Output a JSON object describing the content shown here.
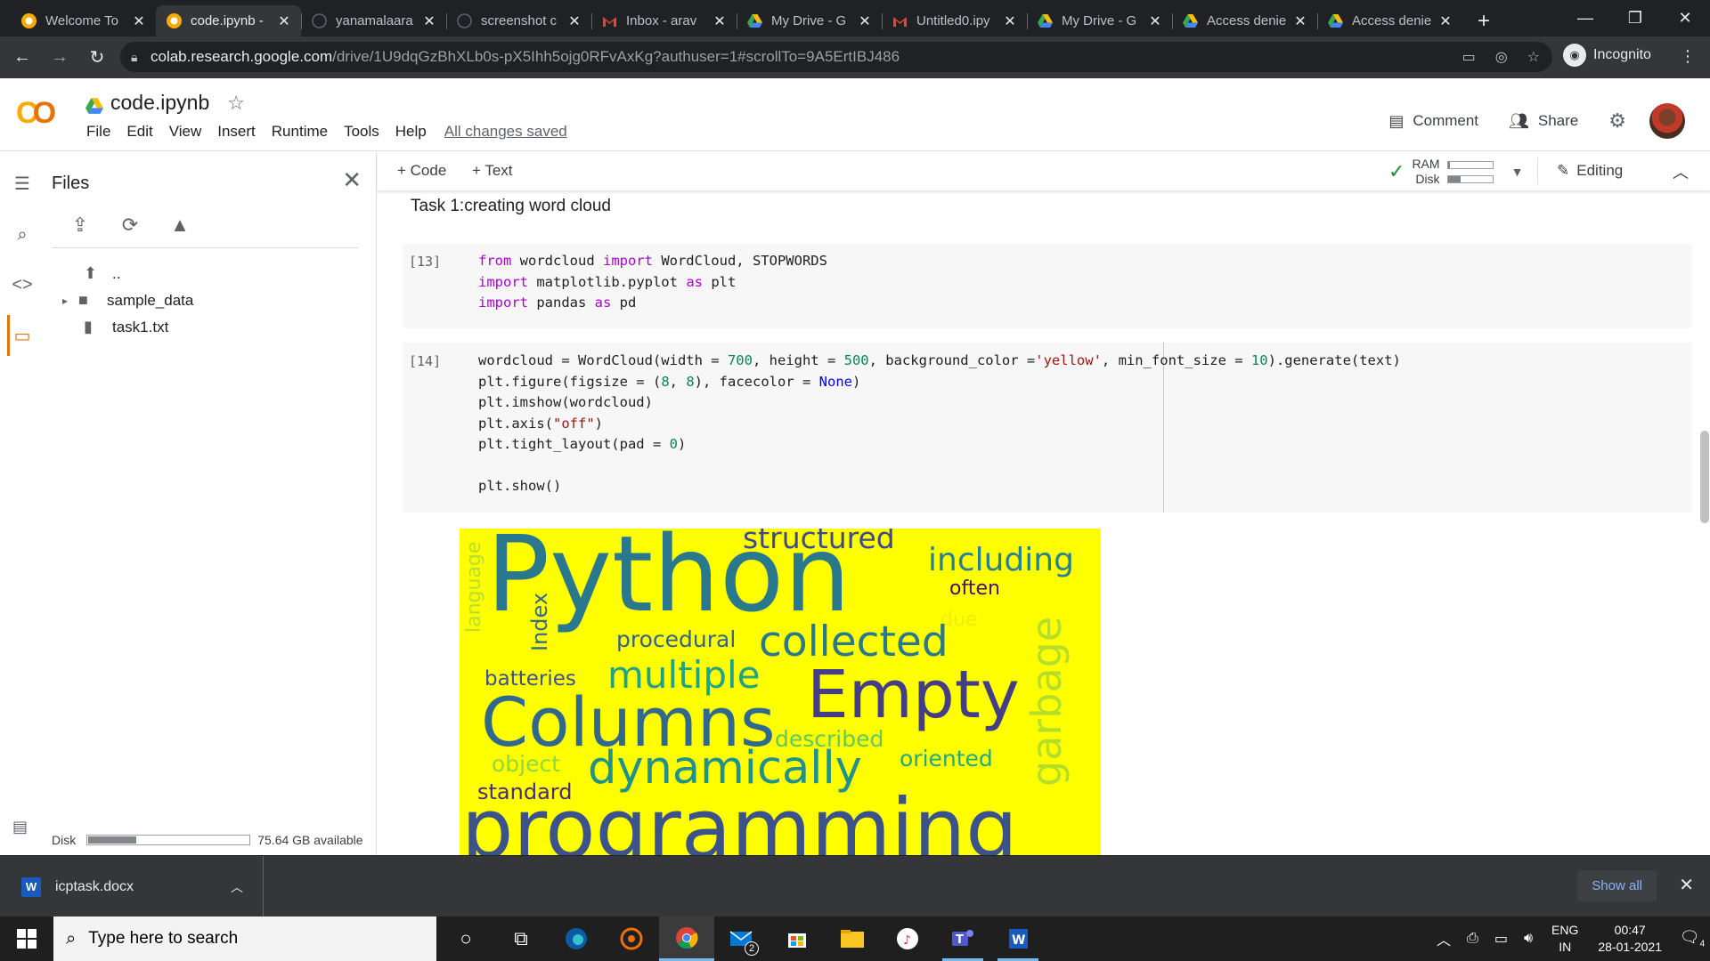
{
  "browser": {
    "tabs": [
      {
        "title": "Welcome To",
        "favicon": "colab-icon",
        "active": false
      },
      {
        "title": "code.ipynb -",
        "favicon": "colab-icon",
        "active": true
      },
      {
        "title": "yanamalaara",
        "favicon": "github-icon",
        "active": false
      },
      {
        "title": "screenshot c",
        "favicon": "github-icon",
        "active": false
      },
      {
        "title": "Inbox - arav",
        "favicon": "gmail-icon",
        "active": false
      },
      {
        "title": "My Drive - G",
        "favicon": "drive-icon",
        "active": false
      },
      {
        "title": "Untitled0.ipy",
        "favicon": "gmail-icon",
        "active": false
      },
      {
        "title": "My Drive - G",
        "favicon": "drive-icon",
        "active": false
      },
      {
        "title": "Access denie",
        "favicon": "drive-icon",
        "active": false
      },
      {
        "title": "Access denie",
        "favicon": "drive-icon",
        "active": false
      }
    ],
    "url_host": "colab.research.google.com",
    "url_path": "/drive/1U9dqGzBhXLb0s-pX5Ihh5ojg0RFvAxKg?authuser=1#scrollTo=9A5ErtIBJ486",
    "incognito_label": "Incognito"
  },
  "colab": {
    "notebook_name": "code.ipynb",
    "menu": [
      "File",
      "Edit",
      "View",
      "Insert",
      "Runtime",
      "Tools",
      "Help"
    ],
    "saved_status": "All changes saved",
    "comment_label": "Comment",
    "share_label": "Share",
    "add_code_label": "Code",
    "add_text_label": "Text",
    "ram_label": "RAM",
    "disk_label": "Disk",
    "ram_usage": 0.04,
    "disk_usage": 0.28,
    "editing_label": "Editing"
  },
  "files_panel": {
    "title": "Files",
    "items": [
      {
        "name": "..",
        "type": "parent-folder"
      },
      {
        "name": "sample_data",
        "type": "folder"
      },
      {
        "name": "task1.txt",
        "type": "file"
      }
    ],
    "disk_label": "Disk",
    "disk_available": "75.64 GB available",
    "disk_usage": 0.3
  },
  "notebook": {
    "text_cell": "Task 1:creating word cloud",
    "cells": [
      {
        "exec": "[13]"
      },
      {
        "exec": "[14]"
      }
    ]
  },
  "wordcloud": {
    "background": "#ffff00",
    "words": [
      "Python",
      "structured",
      "including",
      "often",
      "due",
      "language",
      "Index",
      "procedural",
      "collected",
      "garbage",
      "batteries",
      "multiple",
      "Empty",
      "Columns",
      "described",
      "object",
      "oriented",
      "dynamically",
      "standard",
      "programming"
    ]
  },
  "download_bar": {
    "file_name": "icptask.docx",
    "show_all_label": "Show all"
  },
  "taskbar": {
    "search_placeholder": "Type here to search",
    "mail_badge": "2",
    "lang_top": "ENG",
    "lang_bottom": "IN",
    "time": "00:47",
    "date": "28-01-2021",
    "notification_count": "4"
  }
}
